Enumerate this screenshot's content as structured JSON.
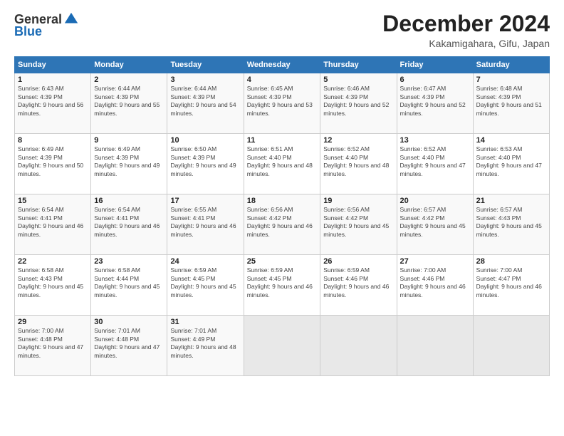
{
  "header": {
    "logo": {
      "general": "General",
      "blue": "Blue"
    },
    "title": "December 2024",
    "location": "Kakamigahara, Gifu, Japan"
  },
  "calendar": {
    "days_of_week": [
      "Sunday",
      "Monday",
      "Tuesday",
      "Wednesday",
      "Thursday",
      "Friday",
      "Saturday"
    ],
    "weeks": [
      [
        {
          "day": "1",
          "sunrise": "6:43 AM",
          "sunset": "4:39 PM",
          "daylight": "9 hours and 56 minutes."
        },
        {
          "day": "2",
          "sunrise": "6:44 AM",
          "sunset": "4:39 PM",
          "daylight": "9 hours and 55 minutes."
        },
        {
          "day": "3",
          "sunrise": "6:44 AM",
          "sunset": "4:39 PM",
          "daylight": "9 hours and 54 minutes."
        },
        {
          "day": "4",
          "sunrise": "6:45 AM",
          "sunset": "4:39 PM",
          "daylight": "9 hours and 53 minutes."
        },
        {
          "day": "5",
          "sunrise": "6:46 AM",
          "sunset": "4:39 PM",
          "daylight": "9 hours and 52 minutes."
        },
        {
          "day": "6",
          "sunrise": "6:47 AM",
          "sunset": "4:39 PM",
          "daylight": "9 hours and 52 minutes."
        },
        {
          "day": "7",
          "sunrise": "6:48 AM",
          "sunset": "4:39 PM",
          "daylight": "9 hours and 51 minutes."
        }
      ],
      [
        {
          "day": "8",
          "sunrise": "6:49 AM",
          "sunset": "4:39 PM",
          "daylight": "9 hours and 50 minutes."
        },
        {
          "day": "9",
          "sunrise": "6:49 AM",
          "sunset": "4:39 PM",
          "daylight": "9 hours and 49 minutes."
        },
        {
          "day": "10",
          "sunrise": "6:50 AM",
          "sunset": "4:39 PM",
          "daylight": "9 hours and 49 minutes."
        },
        {
          "day": "11",
          "sunrise": "6:51 AM",
          "sunset": "4:40 PM",
          "daylight": "9 hours and 48 minutes."
        },
        {
          "day": "12",
          "sunrise": "6:52 AM",
          "sunset": "4:40 PM",
          "daylight": "9 hours and 48 minutes."
        },
        {
          "day": "13",
          "sunrise": "6:52 AM",
          "sunset": "4:40 PM",
          "daylight": "9 hours and 47 minutes."
        },
        {
          "day": "14",
          "sunrise": "6:53 AM",
          "sunset": "4:40 PM",
          "daylight": "9 hours and 47 minutes."
        }
      ],
      [
        {
          "day": "15",
          "sunrise": "6:54 AM",
          "sunset": "4:41 PM",
          "daylight": "9 hours and 46 minutes."
        },
        {
          "day": "16",
          "sunrise": "6:54 AM",
          "sunset": "4:41 PM",
          "daylight": "9 hours and 46 minutes."
        },
        {
          "day": "17",
          "sunrise": "6:55 AM",
          "sunset": "4:41 PM",
          "daylight": "9 hours and 46 minutes."
        },
        {
          "day": "18",
          "sunrise": "6:56 AM",
          "sunset": "4:42 PM",
          "daylight": "9 hours and 46 minutes."
        },
        {
          "day": "19",
          "sunrise": "6:56 AM",
          "sunset": "4:42 PM",
          "daylight": "9 hours and 45 minutes."
        },
        {
          "day": "20",
          "sunrise": "6:57 AM",
          "sunset": "4:42 PM",
          "daylight": "9 hours and 45 minutes."
        },
        {
          "day": "21",
          "sunrise": "6:57 AM",
          "sunset": "4:43 PM",
          "daylight": "9 hours and 45 minutes."
        }
      ],
      [
        {
          "day": "22",
          "sunrise": "6:58 AM",
          "sunset": "4:43 PM",
          "daylight": "9 hours and 45 minutes."
        },
        {
          "day": "23",
          "sunrise": "6:58 AM",
          "sunset": "4:44 PM",
          "daylight": "9 hours and 45 minutes."
        },
        {
          "day": "24",
          "sunrise": "6:59 AM",
          "sunset": "4:45 PM",
          "daylight": "9 hours and 45 minutes."
        },
        {
          "day": "25",
          "sunrise": "6:59 AM",
          "sunset": "4:45 PM",
          "daylight": "9 hours and 46 minutes."
        },
        {
          "day": "26",
          "sunrise": "6:59 AM",
          "sunset": "4:46 PM",
          "daylight": "9 hours and 46 minutes."
        },
        {
          "day": "27",
          "sunrise": "7:00 AM",
          "sunset": "4:46 PM",
          "daylight": "9 hours and 46 minutes."
        },
        {
          "day": "28",
          "sunrise": "7:00 AM",
          "sunset": "4:47 PM",
          "daylight": "9 hours and 46 minutes."
        }
      ],
      [
        {
          "day": "29",
          "sunrise": "7:00 AM",
          "sunset": "4:48 PM",
          "daylight": "9 hours and 47 minutes."
        },
        {
          "day": "30",
          "sunrise": "7:01 AM",
          "sunset": "4:48 PM",
          "daylight": "9 hours and 47 minutes."
        },
        {
          "day": "31",
          "sunrise": "7:01 AM",
          "sunset": "4:49 PM",
          "daylight": "9 hours and 48 minutes."
        },
        null,
        null,
        null,
        null
      ]
    ]
  }
}
